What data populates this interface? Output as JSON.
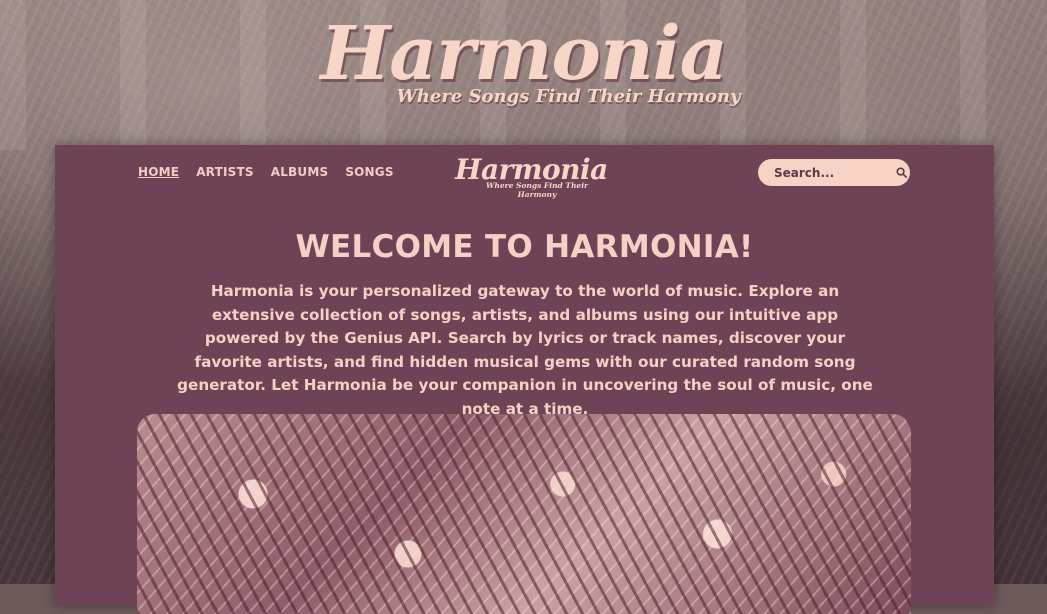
{
  "brand": {
    "title": "Harmonia",
    "tagline": "Where Songs Find Their Harmony"
  },
  "nav": {
    "items": [
      {
        "label": "HOME",
        "active": true
      },
      {
        "label": "ARTISTS",
        "active": false
      },
      {
        "label": "ALBUMS",
        "active": false
      },
      {
        "label": "SONGS",
        "active": false
      }
    ]
  },
  "search": {
    "placeholder": "Search...",
    "icon": "search-icon"
  },
  "main": {
    "heading": "WELCOME TO HARMONIA!",
    "intro": "Harmonia is your personalized gateway to the world of music. Explore an extensive collection of songs, artists, and albums using our intuitive app powered by the Genius API. Search by lyrics or track names, discover your favorite artists, and find hidden musical gems with our curated random song generator. Let Harmonia be your companion in uncovering the soul of music, one note at a time."
  },
  "colors": {
    "panel": "#6e4355",
    "accent_text": "#f6d0c4",
    "search_bg": "#f6d3c5"
  }
}
